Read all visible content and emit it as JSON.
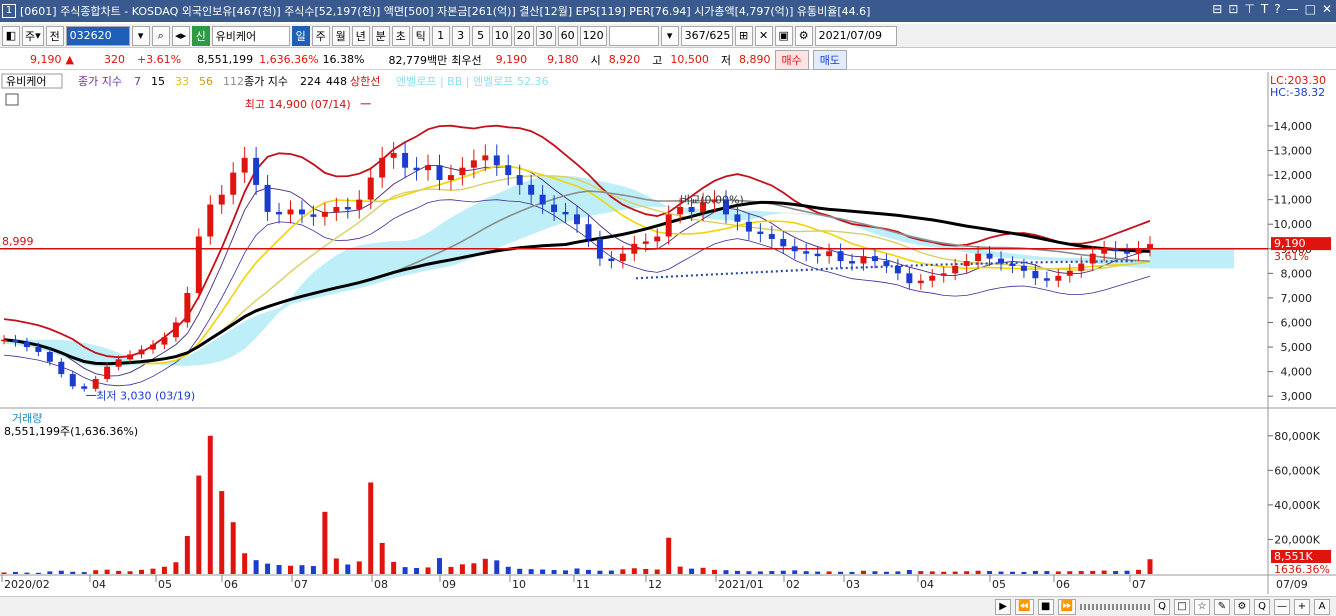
{
  "title": {
    "badge": "1",
    "text": "[0601] 주식종합차트 - KOSDAQ 외국인보유[467(천)] 주식수[52,197(천)] 액면[500] 자본금[261(억)] 결산[12월] EPS[119] PER[76.94] 시가총액[4,797(억)] 유통비율[44.6]",
    "window_icons": [
      "⊟",
      "⊡",
      "⊤",
      "T",
      "?",
      "—",
      "□",
      "✕"
    ]
  },
  "toolbar": {
    "period_select": "주",
    "all_label": "전",
    "stock_code": "032620",
    "stock_name": "유비케어",
    "new_badge": "신",
    "period_buttons": [
      "일",
      "주",
      "월",
      "년",
      "분",
      "초",
      "틱"
    ],
    "interval_buttons": [
      "1",
      "3",
      "5",
      "10",
      "20",
      "30",
      "60",
      "120"
    ],
    "count_display": "367/625",
    "date_input": "2021/07/09"
  },
  "quote": {
    "price": "9,190",
    "arrow": "▲",
    "change": "320",
    "change_pct": "+3.61%",
    "volume": "8,551,199",
    "volume_pct": "1,636.36%",
    "turnover": "16.38%",
    "amount": "82,779백만",
    "best_label": "최우선",
    "best_ask": "9,190",
    "best_bid": "9,180",
    "open_label": "시",
    "open": "8,920",
    "high_label": "고",
    "high": "10,500",
    "low_label": "저",
    "low": "8,890",
    "buy_label": "매수",
    "sell_label": "매도"
  },
  "chart_data": {
    "type": "line",
    "stock": "유비케어",
    "legend": {
      "ma_label": "종가 지수",
      "ma_short": [
        "7",
        "15",
        "33",
        "56",
        "112"
      ],
      "ma_long_label": "종가 지수",
      "ma_long": [
        "224",
        "448"
      ],
      "upper_limit": "상한선",
      "extra": "엔벨로프 | BB | 엔벨로프 52.36"
    },
    "x_ticks": [
      "2020/02",
      "04",
      "05",
      "06",
      "07",
      "08",
      "09",
      "10",
      "11",
      "12",
      "2021/01",
      "02",
      "03",
      "04",
      "05",
      "06",
      "07"
    ],
    "last_date": "07/09",
    "price_axis": {
      "ticks": [
        3000,
        4000,
        5000,
        6000,
        7000,
        8000,
        9000,
        10000,
        11000,
        12000,
        13000,
        14000
      ],
      "tick_labels": [
        "3,000",
        "4,000",
        "5,000",
        "6,000",
        "7,000",
        "8,000",
        "9,000",
        "10,000",
        "11,000",
        "12,000",
        "13,000",
        "14,000"
      ],
      "ylim": [
        2600,
        15300
      ],
      "lc": "LC:203.30",
      "hc": "HC:-38.32",
      "current_price": "9,190",
      "current_pct": "3.61%"
    },
    "reference_line": {
      "value": 8999,
      "label": "8,999"
    },
    "high_annotation": {
      "label": "최고 14,900 (07/14)",
      "value": 14900
    },
    "low_annotation": {
      "label": "최저 3,030 (03/19)",
      "value": 3030
    },
    "mid_annotation": "비교(0.00%)",
    "close_series": [
      5300,
      5200,
      5000,
      4800,
      4400,
      3900,
      3400,
      3300,
      3700,
      4200,
      4500,
      4700,
      4900,
      5100,
      5400,
      6000,
      7200,
      9500,
      10800,
      11200,
      12100,
      12700,
      11600,
      10500,
      10400,
      10600,
      10400,
      10300,
      10500,
      10700,
      10600,
      11000,
      11900,
      12700,
      12900,
      12300,
      12200,
      12400,
      11800,
      12000,
      12300,
      12600,
      12800,
      12400,
      12000,
      11600,
      11200,
      10800,
      10500,
      10400,
      10000,
      9400,
      8600,
      8500,
      8800,
      9200,
      9300,
      9500,
      10400,
      10700,
      10500,
      10900,
      11000,
      10400,
      10100,
      9700,
      9600,
      9400,
      9100,
      8900,
      8800,
      8700,
      8900,
      8500,
      8400,
      8700,
      8500,
      8300,
      8000,
      7600,
      7700,
      7900,
      8000,
      8300,
      8500,
      8800,
      8600,
      8400,
      8300,
      8100,
      7800,
      7700,
      7900,
      8100,
      8400,
      8800,
      9000,
      8900,
      8800,
      9000,
      9190
    ],
    "volume_panel": {
      "label": "거래량",
      "value_label": "8,551,199주(1,636.36%)",
      "ticks": [
        20000,
        40000,
        60000,
        80000
      ],
      "tick_labels": [
        "20,000K",
        "40,000K",
        "60,000K",
        "80,000K"
      ],
      "ylim": [
        0,
        88000
      ],
      "current_label": "8,551K",
      "current_pct": "1636.36%",
      "bars": [
        900,
        1200,
        800,
        700,
        1500,
        1900,
        1300,
        1100,
        2200,
        2500,
        1800,
        1600,
        2400,
        3100,
        4200,
        6800,
        22000,
        57000,
        80000,
        48000,
        30000,
        12000,
        8000,
        6000,
        5200,
        4800,
        5100,
        4600,
        36000,
        9000,
        5500,
        7300,
        53000,
        18000,
        7000,
        4000,
        3500,
        3800,
        9200,
        4100,
        5600,
        6200,
        8800,
        7900,
        4200,
        3000,
        2800,
        2600,
        2300,
        2100,
        3200,
        2400,
        1900,
        2000,
        2700,
        3300,
        2900,
        2600,
        21000,
        4300,
        3100,
        3600,
        2400,
        2200,
        1800,
        1600,
        1500,
        1700,
        1900,
        2100,
        1600,
        1400,
        1500,
        1300,
        1200,
        1900,
        1600,
        1300,
        1500,
        2300,
        1700,
        1500,
        1300,
        1400,
        1600,
        1900,
        1700,
        1400,
        1300,
        1200,
        1800,
        1700,
        1500,
        1600,
        1700,
        1800,
        2000,
        1700,
        1900,
        2400,
        8551
      ]
    },
    "colors": {
      "up": "#e0140f",
      "down": "#1a3ccf",
      "bollinger": "#c4101a",
      "ma_black": "#000000",
      "ma_gray": "#8c8c8c",
      "ma_yellow": "#f2d400",
      "ma_khaki": "#d8d062",
      "cloud": "#a8eaf5",
      "dotted": "#2a4aa8"
    }
  },
  "bottom_toolbar": [
    "▶",
    "⏪",
    "■",
    "⏩",
    "Q",
    "□",
    "☆",
    "✎",
    "⚙",
    "Q",
    "—",
    "+",
    "A"
  ]
}
